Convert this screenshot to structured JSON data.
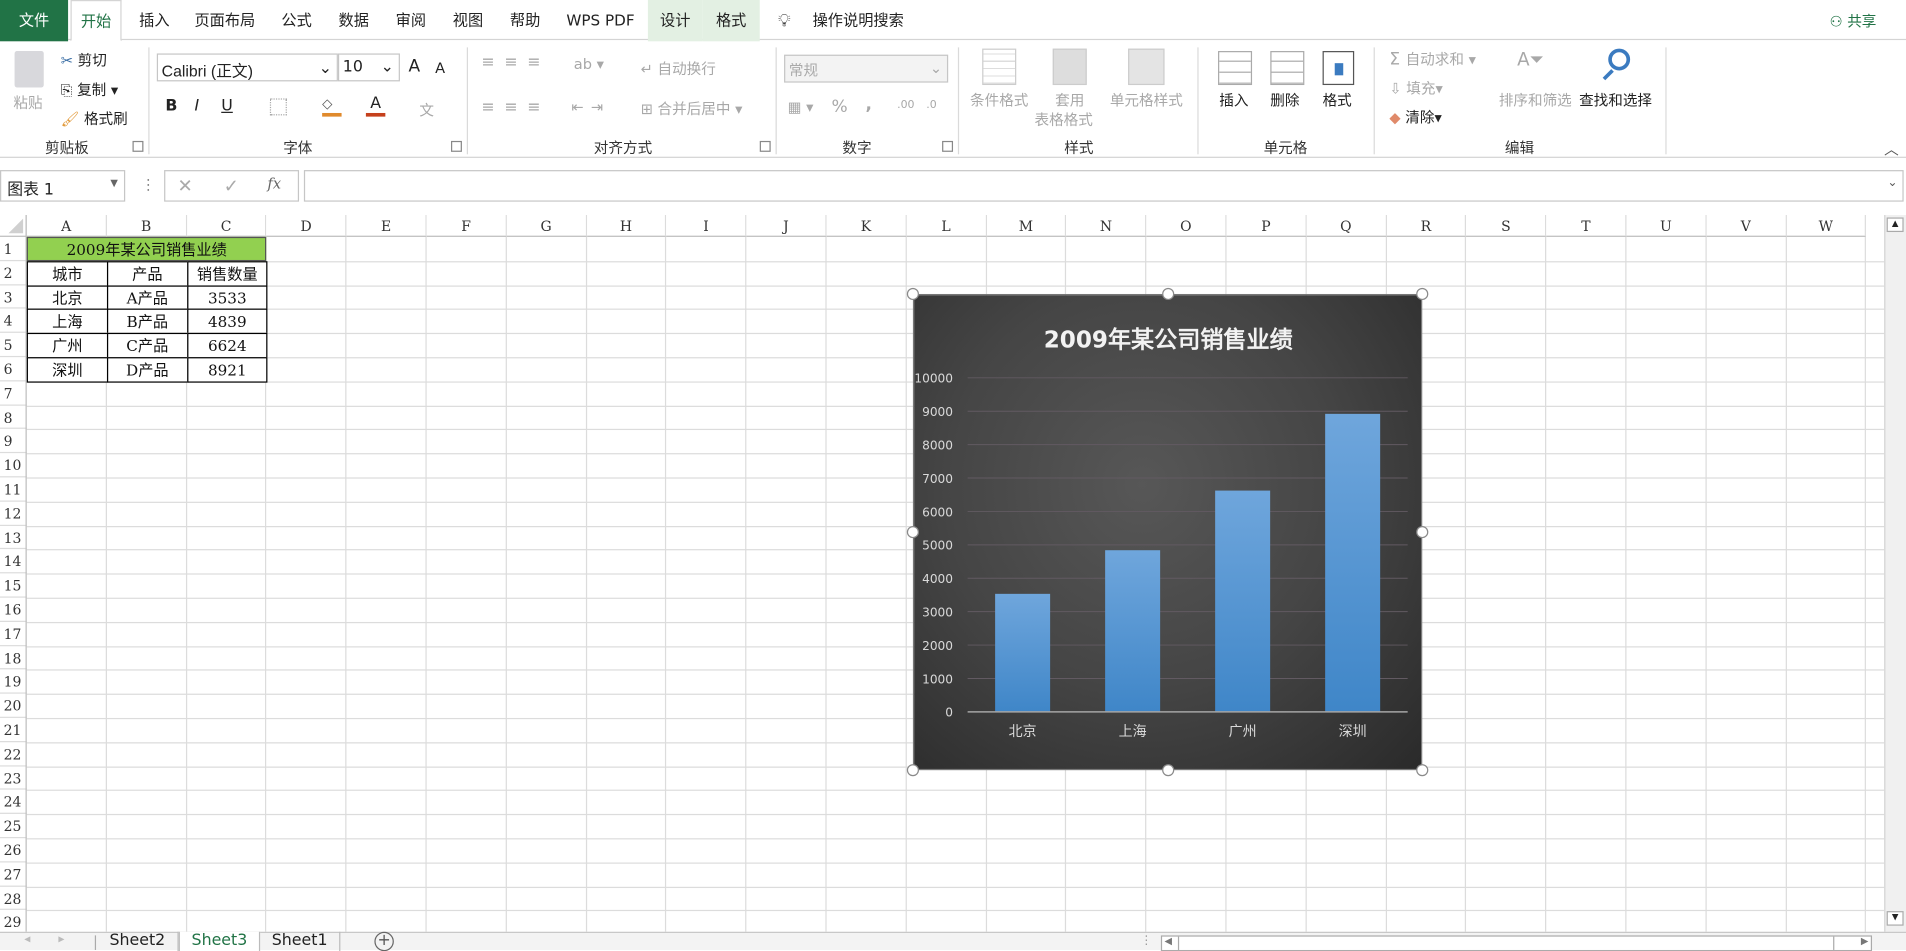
{
  "tabs": {
    "file": "文件",
    "home": "开始",
    "insert": "插入",
    "layout": "页面布局",
    "formulas": "公式",
    "data": "数据",
    "review": "审阅",
    "view": "视图",
    "help": "帮助",
    "wps": "WPS PDF",
    "design": "设计",
    "format": "格式",
    "tell": "操作说明搜索",
    "share": "共享"
  },
  "ribbon": {
    "clipboard": {
      "paste": "粘贴",
      "cut": "剪切",
      "copy": "复制",
      "painter": "格式刷",
      "label": "剪贴板"
    },
    "font": {
      "name": "Calibri (正文)",
      "size": "10",
      "bold": "B",
      "italic": "I",
      "underline": "U",
      "label": "字体",
      "grow": "A",
      "shrink": "A",
      "phonetic": "文"
    },
    "align": {
      "wrap": "自动换行",
      "merge": "合并后居中",
      "label": "对齐方式"
    },
    "number": {
      "format": "常规",
      "percent": "%",
      "comma": ",",
      "inc": ".00",
      "dec": ".0",
      "label": "数字"
    },
    "styles": {
      "cond": "条件格式",
      "table1": "套用",
      "table2": "表格格式",
      "cell": "单元格样式",
      "label": "样式"
    },
    "cells": {
      "insert": "插入",
      "delete": "删除",
      "format": "格式",
      "label": "单元格"
    },
    "edit": {
      "autosum": "自动求和",
      "fill": "填充",
      "clear": "清除",
      "sort": "排序和筛选",
      "find": "查找和选择",
      "label": "编辑"
    }
  },
  "formula_bar": {
    "name_box": "图表 1",
    "fx": "fx",
    "value": ""
  },
  "columns": [
    "A",
    "B",
    "C",
    "D",
    "E",
    "F",
    "G",
    "H",
    "I",
    "J",
    "K",
    "L",
    "M",
    "N",
    "O",
    "P",
    "Q",
    "R",
    "S",
    "T",
    "U",
    "V",
    "W"
  ],
  "rows": [
    "1",
    "2",
    "3",
    "4",
    "5",
    "6",
    "7",
    "8",
    "9",
    "10",
    "11",
    "12",
    "13",
    "14",
    "15",
    "16",
    "17",
    "18",
    "19",
    "20",
    "21",
    "22",
    "23",
    "24",
    "25",
    "26",
    "27",
    "28",
    "29"
  ],
  "table": {
    "title": "2009年某公司销售业绩",
    "headers": [
      "城市",
      "产品",
      "销售数量"
    ],
    "rows": [
      [
        "北京",
        "A产品",
        "3533"
      ],
      [
        "上海",
        "B产品",
        "4839"
      ],
      [
        "广州",
        "C产品",
        "6624"
      ],
      [
        "深圳",
        "D产品",
        "8921"
      ]
    ]
  },
  "sheets": [
    "Sheet2",
    "Sheet3",
    "Sheet1"
  ],
  "active_sheet": "Sheet3",
  "colors": {
    "excel_green": "#217346",
    "title_fill": "#92d050",
    "bar": "#5b9bd5"
  },
  "chart_data": {
    "type": "bar",
    "title": "2009年某公司销售业绩",
    "categories": [
      "北京",
      "上海",
      "广州",
      "深圳"
    ],
    "values": [
      3533,
      4839,
      6624,
      8921
    ],
    "ylim": [
      0,
      10000
    ],
    "yticks": [
      "0",
      "1000",
      "2000",
      "3000",
      "4000",
      "5000",
      "6000",
      "7000",
      "8000",
      "9000",
      "10000"
    ],
    "grid": true,
    "xlabel": "",
    "ylabel": ""
  }
}
